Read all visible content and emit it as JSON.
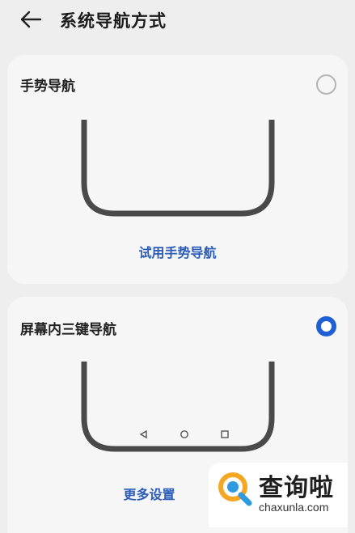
{
  "header": {
    "back_icon": "arrow-left-icon",
    "title": "系统导航方式"
  },
  "options": [
    {
      "label": "手势导航",
      "selected": false,
      "preview": "phone-bottom-gesture",
      "link": "试用手势导航"
    },
    {
      "label": "屏幕内三键导航",
      "selected": true,
      "preview": "phone-bottom-three-keys",
      "nav_keys": [
        "back-triangle-icon",
        "home-circle-icon",
        "recent-square-icon"
      ],
      "link": "更多设置"
    }
  ],
  "watermark": {
    "text": "查询啦",
    "url": "chaxunla.com"
  },
  "colors": {
    "accent": "#1e5fd6",
    "link": "#2a5cb8",
    "background": "#eeeeee",
    "card": "#f6f6f6"
  }
}
